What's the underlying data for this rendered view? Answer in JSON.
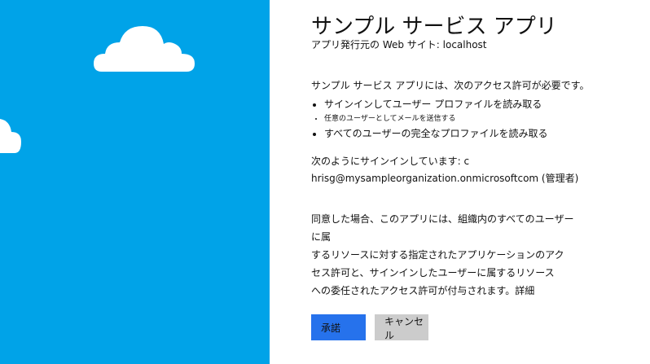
{
  "app": {
    "title": "サンプル サービス アプリ",
    "publisher": "アプリ発行元の Web サイト: localhost"
  },
  "permissions": {
    "intro": "サンプル サービス アプリには、次のアクセス許可が必要です。",
    "items": [
      "サインインしてユーザー プロファイルを読み取る",
      "任意のユーザーとしてメールを送信する",
      "すべてのユーザーの完全なプロファイルを読み取る"
    ]
  },
  "signed_in": {
    "label": "次のようにサインインしています: c",
    "account": "hrisg@mysampleorganization.onmicrosoftcom (管理者)"
  },
  "consent": {
    "lines": [
      "同意した場合、このアプリには、組織内のすべてのユーザーに属",
      "するリソースに対する指定されたアプリケーションのアク",
      "セス許可と、サインインしたユーザーに属するリソース",
      "への委任されたアクセス許可が付与されます。"
    ],
    "details_link": "詳細"
  },
  "buttons": {
    "accept": "承諾",
    "cancel": "キャンセル"
  },
  "colors": {
    "panel": "#00a3e8",
    "accept": "#2672ec",
    "cancel": "#cccccc"
  }
}
